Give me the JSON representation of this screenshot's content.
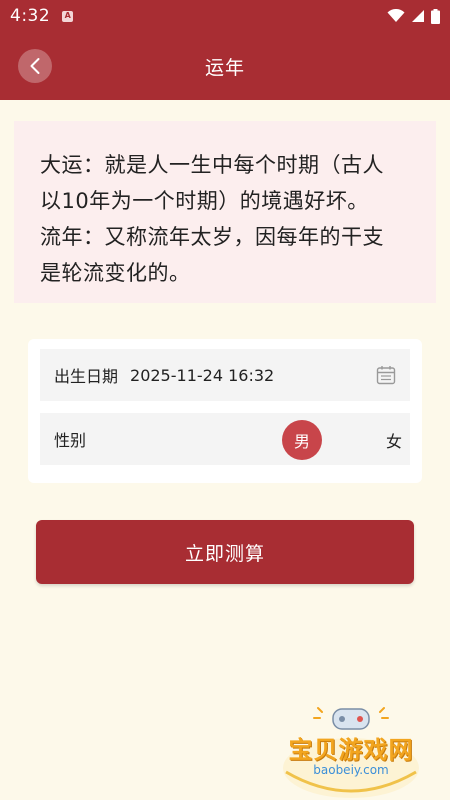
{
  "status_bar": {
    "time": "4:32",
    "notification_glyph": "A",
    "icons": [
      "wifi-icon",
      "signal-icon",
      "battery-icon"
    ]
  },
  "app_bar": {
    "title": "运年",
    "back_icon": "back-arrow-icon"
  },
  "info": {
    "lines": [
      "大运：就是人一生中每个时期（古人",
      "以10年为一个时期）的境遇好坏。",
      "流年：又称流年太岁，因每年的干支",
      "是轮流变化的。"
    ]
  },
  "form": {
    "birth_label": "出生日期",
    "birth_value": "2025-11-24 16:32",
    "gender_label": "性别",
    "gender_male": "男",
    "gender_female": "女",
    "gender_selected": "男"
  },
  "submit_label": "立即测算",
  "watermark": {
    "text": "宝贝游戏网",
    "url": "baobeiy.com"
  },
  "colors": {
    "primary": "#a82d33",
    "background": "#fdf9ea",
    "info_background": "#fceeee",
    "selected": "#c8454a"
  }
}
